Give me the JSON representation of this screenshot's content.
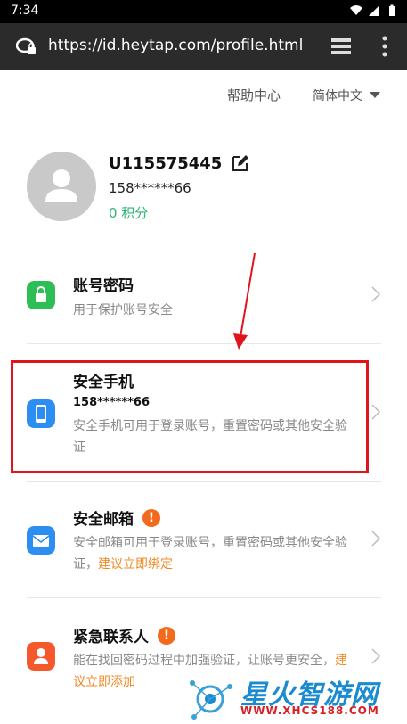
{
  "status_bar": {
    "time": "7:34",
    "icons": [
      "wifi-icon",
      "signal-icon",
      "battery-icon"
    ]
  },
  "browser": {
    "url": "https://id.heytap.com/profile.html",
    "icons": [
      "secure-lock-icon",
      "tabs-icon",
      "more-menu-icon"
    ]
  },
  "top_nav": {
    "help": "帮助中心",
    "language": "简体中文"
  },
  "profile": {
    "username": "U115575445",
    "phone": "158******66",
    "points": "0 积分"
  },
  "items": [
    {
      "title": "账号密码",
      "desc": "用于保护账号安全",
      "icon": "lock-icon",
      "color": "#2dbf55"
    },
    {
      "title": "安全手机",
      "value": "158******66",
      "desc": "安全手机可用于登录账号，重置密码或其他安全验证",
      "icon": "phone-icon",
      "color": "#2c8ef0"
    },
    {
      "title": "安全邮箱",
      "desc": "安全邮箱可用于登录账号，重置密码或其他安全验证，",
      "link": "建议立即绑定",
      "icon": "mail-icon",
      "color": "#2c8ef0",
      "warning": "!"
    },
    {
      "title": "紧急联系人",
      "desc": "能在找回密码过程中加强验证，让账号更安全，",
      "link": "建议立即添加",
      "icon": "contact-icon",
      "color": "#f4582b",
      "warning": "!"
    }
  ],
  "watermark": {
    "brand": "星火智游网",
    "site": "WWW.XHCS188.COM"
  },
  "colors": {
    "accent_green": "#2bb673",
    "link_orange": "#f08a24",
    "highlight_red": "#e0141b"
  }
}
